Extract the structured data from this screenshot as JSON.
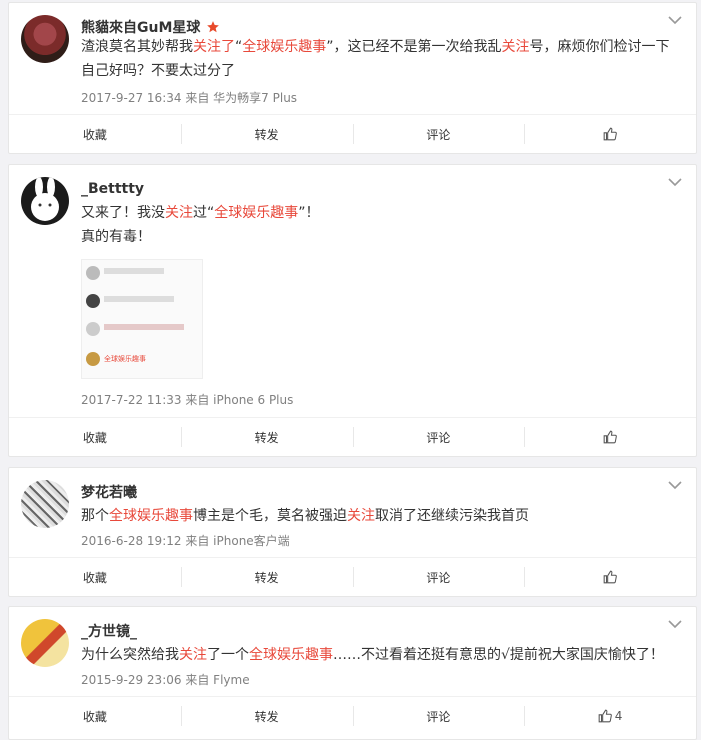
{
  "comments": [
    {
      "name": "熊貓來自GuM星球",
      "text_parts": [
        "渣浪莫名其妙帮我",
        "关注了",
        "“",
        "全球娱乐趣事",
        "”，这已经不是第一次给我乱",
        "关注",
        "号，麻烦你们检讨一下自己好吗？不要太过分了"
      ],
      "time": "2017-9-27 16:34",
      "from_label": "来自",
      "source": "华为畅享7 Plus",
      "badge_icon": "red-star-icon"
    },
    {
      "name": "_Betttty",
      "line1_parts": [
        "又来了！我没",
        "关注",
        "过“",
        "全球娱乐趣事",
        "”！"
      ],
      "line2": "真的有毒！",
      "attached_image_caption": "全球娱乐趣事",
      "time": "2017-7-22 11:33",
      "from_label": "来自",
      "source": "iPhone 6 Plus"
    },
    {
      "name": "梦花若曦",
      "text_parts": [
        "那个",
        "全球娱乐趣事",
        "博主是个毛，莫名被强迫",
        "关注",
        "取消了还继续污染我首页"
      ],
      "time": "2016-6-28 19:12",
      "from_label": "来自",
      "source": "iPhone客户端"
    },
    {
      "name": "_方世镜_",
      "text_parts": [
        "为什么突然给我",
        "关注",
        "了一个",
        "全球娱乐趣事",
        "……不过看着还挺有意思的√提前祝大家国庆愉快了！"
      ],
      "time": "2015-9-29 23:06",
      "from_label": "来自",
      "source": "Flyme",
      "like_count": "4"
    }
  ],
  "actions": {
    "favorite": "收藏",
    "forward": "转发",
    "comment": "评论"
  },
  "colors": {
    "highlight": "#e8493b",
    "meta": "#808080",
    "background": "#f2f2f5"
  }
}
